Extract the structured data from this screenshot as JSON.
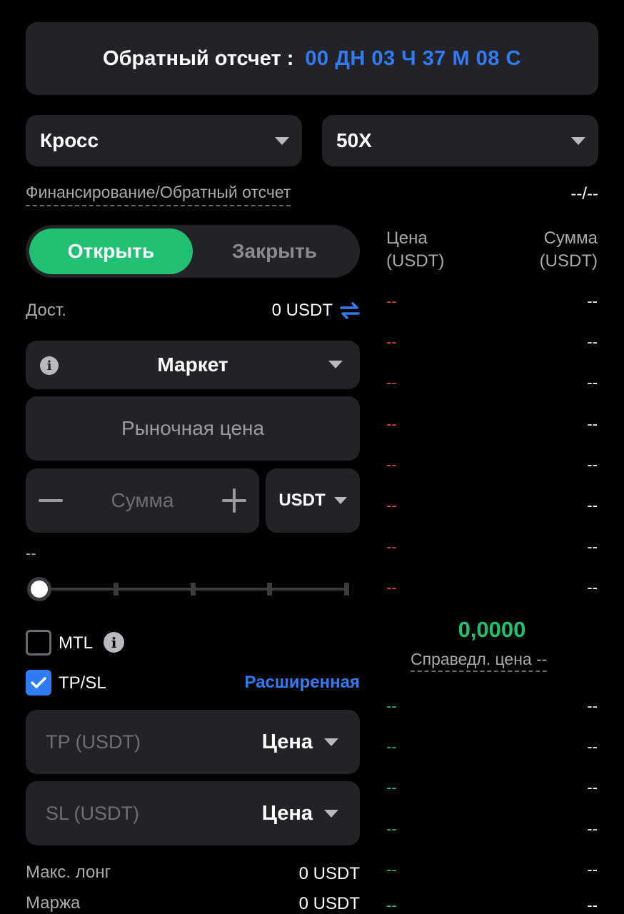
{
  "countdown": {
    "label": "Обратный отсчет :",
    "value": "00 ДН 03 Ч 37 М 08 С"
  },
  "margin_mode": {
    "value": "Кросс"
  },
  "leverage": {
    "value": "50X"
  },
  "funding": {
    "label": "Финансирование/Обратный отсчет",
    "value": "--/--"
  },
  "tabs": {
    "open": "Открыть",
    "close": "Закрыть"
  },
  "available": {
    "label": "Дост.",
    "value": "0 USDT",
    "transfer_icon": "transfer-arrows-icon"
  },
  "order_type": {
    "value": "Маркет",
    "info_glyph": "i"
  },
  "price_field": {
    "placeholder": "Рыночная цена"
  },
  "amount": {
    "placeholder": "Сумма",
    "unit": "USDT"
  },
  "amount_hint": "--",
  "slider": {
    "percent": 0,
    "ticks": [
      25,
      50,
      75,
      100
    ]
  },
  "mtl": {
    "label": "MTL",
    "checked": false,
    "info_glyph": "i"
  },
  "tpsl": {
    "label": "TP/SL",
    "checked": true,
    "advanced": "Расширенная"
  },
  "tp_field": {
    "placeholder": "TP (USDT)",
    "type": "Цена"
  },
  "sl_field": {
    "placeholder": "SL (USDT)",
    "type": "Цена"
  },
  "max_long": {
    "label": "Макс. лонг",
    "value": "0 USDT"
  },
  "margin": {
    "label": "Маржа",
    "value": "0 USDT"
  },
  "orderbook": {
    "price_header": "Цена",
    "price_unit": "(USDT)",
    "amount_header": "Сумма",
    "amount_unit": "(USDT)",
    "asks": [
      {
        "price": "--",
        "amount": "--"
      },
      {
        "price": "--",
        "amount": "--"
      },
      {
        "price": "--",
        "amount": "--"
      },
      {
        "price": "--",
        "amount": "--"
      },
      {
        "price": "--",
        "amount": "--"
      },
      {
        "price": "--",
        "amount": "--"
      },
      {
        "price": "--",
        "amount": "--"
      },
      {
        "price": "--",
        "amount": "--"
      }
    ],
    "mid_price": "0,0000",
    "fair_price": "Справедл. цена --",
    "bids": [
      {
        "price": "--",
        "amount": "--"
      },
      {
        "price": "--",
        "amount": "--"
      },
      {
        "price": "--",
        "amount": "--"
      },
      {
        "price": "--",
        "amount": "--"
      },
      {
        "price": "--",
        "amount": "--"
      },
      {
        "price": "--",
        "amount": "--"
      }
    ]
  },
  "colors": {
    "accent_blue": "#2f7cf6",
    "green": "#20c172",
    "red": "#e0454a",
    "panel": "#232327"
  }
}
